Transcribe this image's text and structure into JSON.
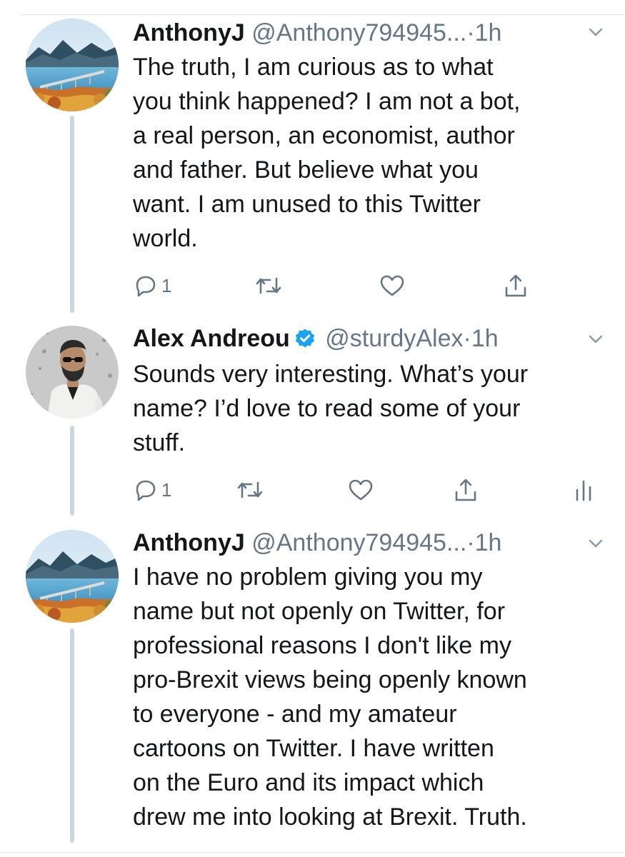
{
  "tweets": [
    {
      "name": "AnthonyJ",
      "handle": "@Anthony794945...",
      "dot": "·",
      "time": "1h",
      "avatar": "landscape-lake-bridge-avatar",
      "text": "The truth, I am curious as to what\nyou think happened? I am not a bot,\na real person, an economist, author\nand father. But believe what you\nwant. I am unused to this Twitter\nworld.",
      "reply_count": "1"
    },
    {
      "name": "Alex Andreou",
      "verified": true,
      "handle": "@sturdyAlex",
      "dot": "·",
      "time": "1h",
      "avatar": "man-in-sunglasses-avatar",
      "text": "Sounds very interesting. What’s your\nname? I’d love to read some of your\nstuff.",
      "reply_count": "1"
    },
    {
      "name": "AnthonyJ",
      "handle": "@Anthony794945...",
      "dot": "·",
      "time": "1h",
      "avatar": "landscape-lake-bridge-avatar",
      "text": "I have no problem giving you my\nname but not openly on Twitter, for\nprofessional reasons I don't like my\npro-Brexit views being openly known\nto everyone - and my amateur\ncartoons on Twitter. I have written\non the Euro and its impact which\ndrew me into looking at Brexit. Truth."
    }
  ],
  "colors": {
    "text": "#14171a",
    "secondary": "#657786",
    "verified": "#1da1f2",
    "thread_line": "#ccd6dd"
  },
  "icons": [
    "reply-icon",
    "retweet-icon",
    "like-icon",
    "share-icon",
    "analytics-icon",
    "chevron-down-icon",
    "verified-badge-icon"
  ]
}
